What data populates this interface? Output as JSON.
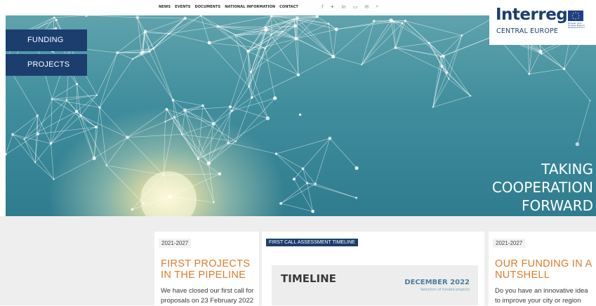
{
  "topnav": {
    "items": [
      "NEWS",
      "EVENTS",
      "DOCUMENTS",
      "NATIONAL INFORMATION",
      "CONTACT"
    ]
  },
  "social": {
    "icons": [
      "twitter-icon",
      "twitter-bird-icon",
      "linkedin-icon",
      "youtube-icon",
      "mail-icon",
      "search-icon"
    ],
    "glyphs": [
      "f",
      "✦",
      "in",
      "▭",
      "✉",
      "⌕"
    ]
  },
  "sidenav": {
    "items": [
      "FUNDING",
      "PROJECTS"
    ]
  },
  "logo": {
    "word": "Interreg",
    "sub": "CENTRAL EUROPE",
    "eu_text": "European Union European Regional Development Fund"
  },
  "hero": {
    "tagline": [
      "TAKING",
      "COOPERATION",
      "FORWARD"
    ]
  },
  "cards": [
    {
      "tag": "2021-2027",
      "title": "FIRST PROJECTS IN THE PIPELINE",
      "text": "We have closed our first call for proposals on 23 February 2022"
    },
    {
      "tag": "FIRST CALL ASSESSMENT TIMELINE",
      "image_title": "TIMELINE",
      "image_date": "DECEMBER 2022",
      "image_sub": "Selection of funded projects"
    },
    {
      "tag": "2021-2027",
      "title": "OUR FUNDING IN A NUTSHELL",
      "text": "Do you have an innovative idea to improve your city or region"
    }
  ],
  "colors": {
    "navy": "#1b3e6f",
    "orange": "#e07b2a",
    "section_bg": "#eeeeee"
  }
}
